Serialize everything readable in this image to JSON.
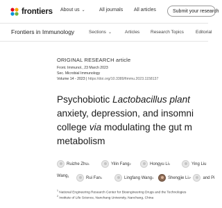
{
  "header": {
    "logo_text": "frontiers",
    "nav": [
      "About us",
      "All journals",
      "All articles"
    ],
    "submit_label": "Submit your research"
  },
  "journal_bar": {
    "title": "Frontiers in Immunology",
    "nav": [
      "Sections",
      "Articles",
      "Research Topics",
      "Editorial"
    ]
  },
  "article": {
    "type": "ORIGINAL RESEARCH article",
    "journal_line": "Front. Immunol., 23 March 2023",
    "section_line": "Sec. Microbial Immunology",
    "volume_line": "Volume 14 - 2023 |",
    "doi": "https://doi.org/10.3389/fimmu.2023.1158137",
    "title_lines": {
      "line1_prefix": "Psychobiotic ",
      "line1_italic": "Lactobacillus plant",
      "line2": "anxiety, depression, and insomni",
      "line3_prefix": "college ",
      "line3_italic": "via",
      "line3_suffix": " modulating the gut m",
      "line4": "metabolism"
    },
    "authors_row1": [
      "Ruizhe Zhu",
      "Yilin Fang",
      "Hongyu Li",
      "Ying Liu"
    ],
    "authors_row1_sup": [
      "1",
      "2",
      "1",
      ""
    ],
    "authors_row2": [
      "Wang",
      "Rui Fan",
      "Lingfang Wang",
      "Shengjie Li",
      "and Pi"
    ],
    "authors_row2_sup": [
      "1",
      "1",
      "1",
      "2*",
      ""
    ],
    "affiliations": [
      "National Engineering Research Center for Bioengineering Drugs and the Technologies",
      "Institute of Life Science, Nanchang University, Nanchang, China"
    ],
    "affiliation_marks": [
      "1",
      "2"
    ]
  }
}
